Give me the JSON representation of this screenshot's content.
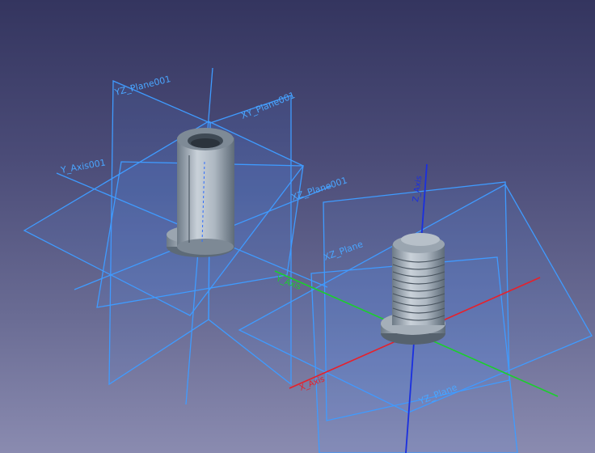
{
  "view": {
    "background_top": "#34355f",
    "background_bottom": "#8a8bb0",
    "plane_color": "#3f9bff"
  },
  "labels": {
    "left_yz_plane": "YZ_Plane001",
    "left_xy_plane": "XY_Plane001",
    "left_y_axis": "Y_Axis001",
    "left_xz_plane": "XZ_Plane001",
    "right_z_axis": "Z_Axis",
    "right_x_axis": "X_Axis",
    "right_y_axis": "Y_Axis",
    "right_xz_plane": "XZ_Plane",
    "right_yz_plane": "YZ_Plane"
  },
  "axis_colors": {
    "x": "#e8202a",
    "y": "#1bcf2c",
    "z": "#1a2fe0"
  }
}
